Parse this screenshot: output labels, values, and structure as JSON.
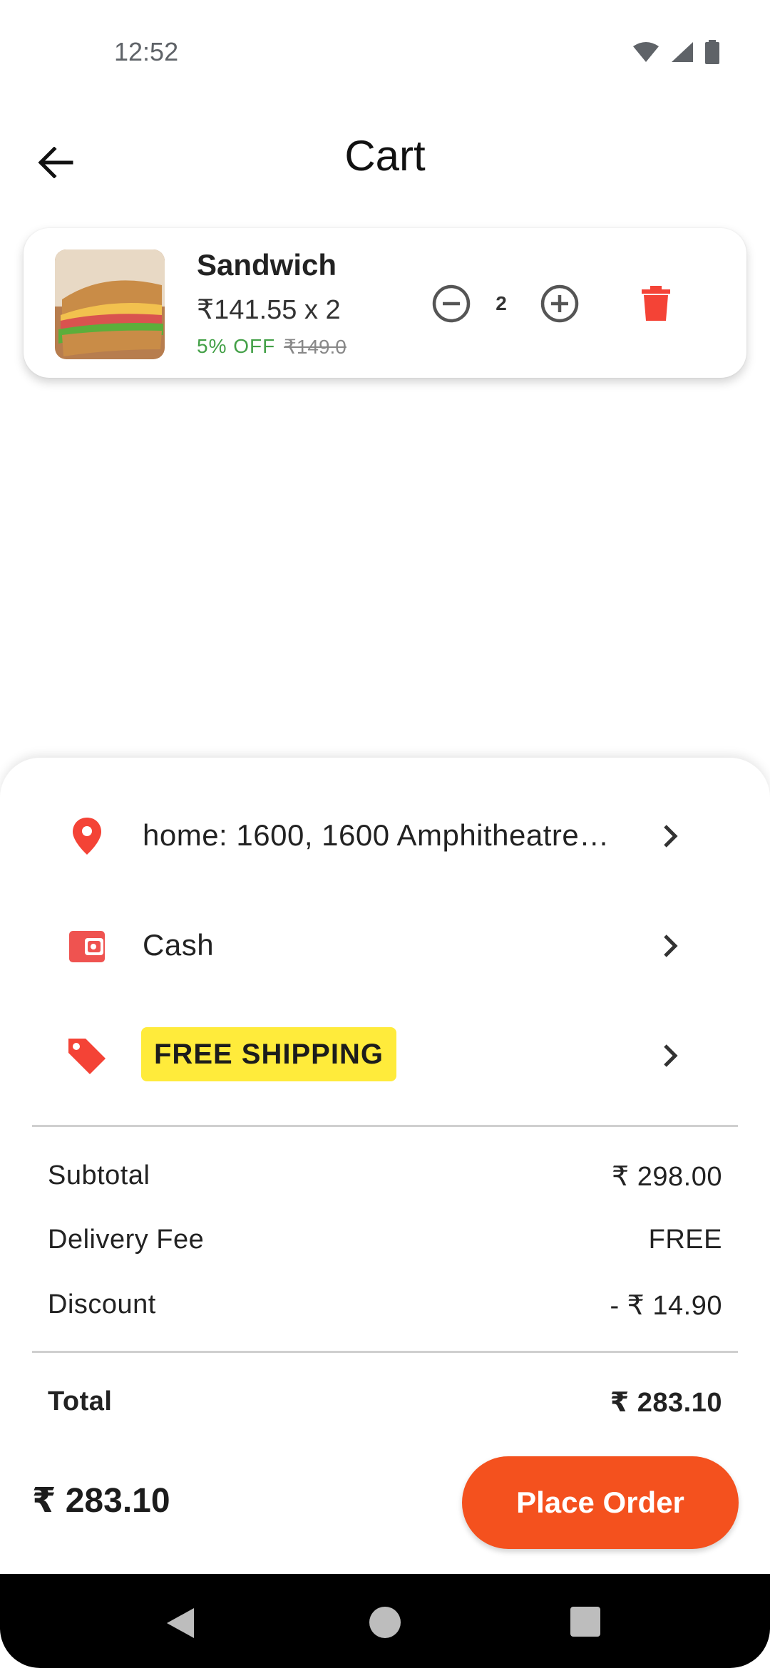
{
  "status_bar": {
    "time": "12:52",
    "icons": [
      "wifi-icon",
      "signal-icon",
      "battery-icon"
    ]
  },
  "app_bar": {
    "title": "Cart",
    "back_icon": "arrow-back-icon"
  },
  "cart_items": [
    {
      "name": "Sandwich",
      "price_line": "₹141.55 x 2",
      "discount": "5% OFF",
      "original_price": "₹149.0",
      "quantity": "2",
      "image": "sandwich-photo"
    }
  ],
  "options": {
    "address": {
      "icon": "location-pin-icon",
      "text": "home: 1600, 1600 Amphitheatre Parkway"
    },
    "payment": {
      "icon": "wallet-icon",
      "text": "Cash"
    },
    "coupon": {
      "icon": "tag-icon",
      "text": "FREE SHIPPING"
    }
  },
  "summary": {
    "subtotal": {
      "label": "Subtotal",
      "value": "₹ 298.00"
    },
    "delivery_fee": {
      "label": "Delivery Fee",
      "value": "FREE"
    },
    "discount": {
      "label": "Discount",
      "value": "- ₹ 14.90"
    },
    "total": {
      "label": "Total",
      "value": "₹ 283.10"
    }
  },
  "footer": {
    "total": "₹ 283.10",
    "place_order_label": "Place Order"
  },
  "colors": {
    "accent": "#f4511e",
    "delete": "#f44336",
    "coupon_badge": "#ffeb3b",
    "discount_text": "#43a047",
    "location_pin": "#f44336"
  }
}
